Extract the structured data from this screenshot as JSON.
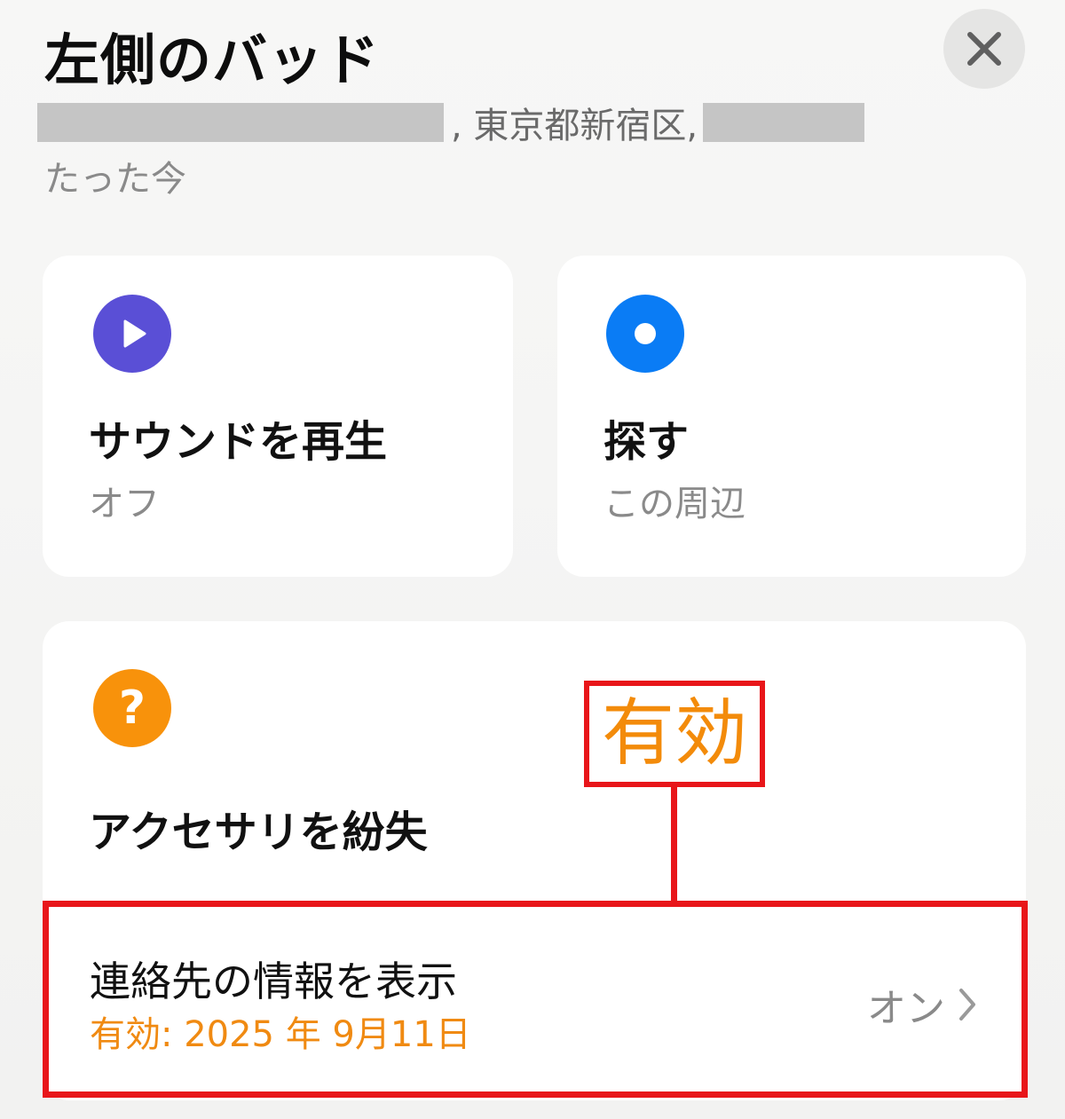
{
  "header": {
    "title": "左側のバッド",
    "address_middle": ", 東京都新宿区,",
    "timestamp": "たった今",
    "close_icon": "close-icon"
  },
  "actions": {
    "sound": {
      "icon": "play-icon",
      "icon_color": "#5a4fd6",
      "title": "サウンドを再生",
      "status": "オフ"
    },
    "find": {
      "icon": "find-nearby-icon",
      "icon_color": "#0a7cf5",
      "title": "探す",
      "status": "この周辺"
    }
  },
  "lost_mode": {
    "icon": "question-icon",
    "icon_color": "#f8920b",
    "icon_glyph": "?",
    "title": "アクセサリを紛失",
    "contact_row": {
      "title": "連絡先の情報を表示",
      "validity": "有効: 2025 年 9月11日",
      "status": "オン"
    }
  },
  "annotation": {
    "label": "有効",
    "label_color": "#f38b0a",
    "frame_color": "#e8161a"
  }
}
